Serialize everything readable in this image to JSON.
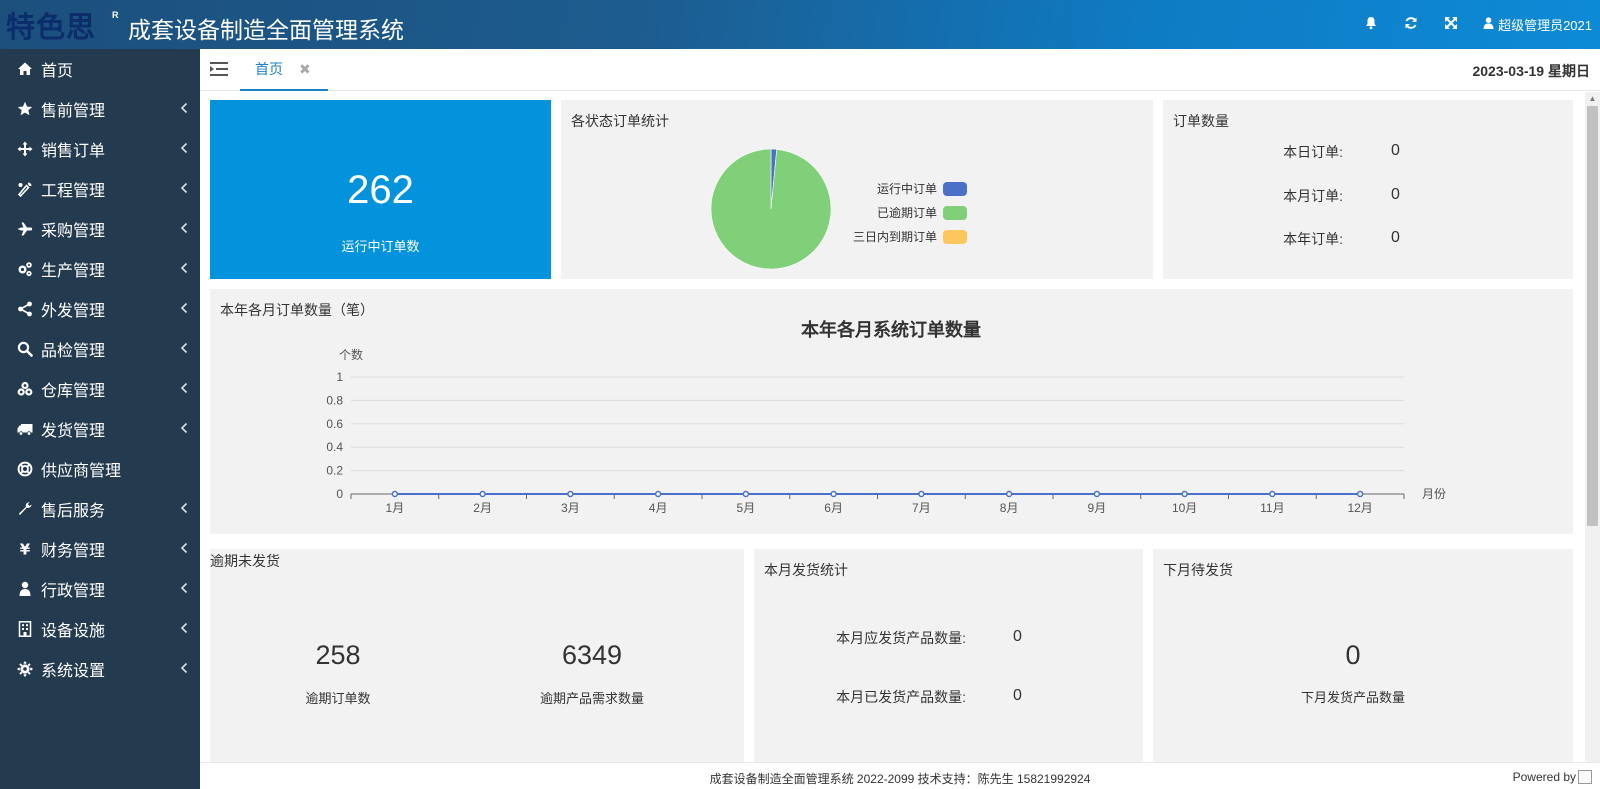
{
  "header": {
    "logo": "特色思",
    "logo_mark": "R",
    "title": "成套设备制造全面管理系统",
    "user": "超级管理员2021",
    "icons": [
      "bell-icon",
      "refresh-icon",
      "fullscreen-icon",
      "user-icon"
    ]
  },
  "sidebar": {
    "items": [
      {
        "label": "首页",
        "icon": "home-icon",
        "has_children": false
      },
      {
        "label": "售前管理",
        "icon": "star-icon",
        "has_children": true
      },
      {
        "label": "销售订单",
        "icon": "arrows-icon",
        "has_children": true
      },
      {
        "label": "工程管理",
        "icon": "wrench-tool-icon",
        "has_children": true
      },
      {
        "label": "采购管理",
        "icon": "plane-icon",
        "has_children": true
      },
      {
        "label": "生产管理",
        "icon": "gears-icon",
        "has_children": true
      },
      {
        "label": "外发管理",
        "icon": "share-icon",
        "has_children": true
      },
      {
        "label": "品检管理",
        "icon": "search-icon",
        "has_children": true
      },
      {
        "label": "仓库管理",
        "icon": "cubes-icon",
        "has_children": true
      },
      {
        "label": "发货管理",
        "icon": "truck-icon",
        "has_children": true
      },
      {
        "label": "供应商管理",
        "icon": "lifebuoy-icon",
        "has_children": false
      },
      {
        "label": "售后服务",
        "icon": "wrench-icon",
        "has_children": true
      },
      {
        "label": "财务管理",
        "icon": "yen-icon",
        "has_children": true
      },
      {
        "label": "行政管理",
        "icon": "person-icon",
        "has_children": true
      },
      {
        "label": "设备设施",
        "icon": "building-icon",
        "has_children": true
      },
      {
        "label": "系统设置",
        "icon": "gear-icon",
        "has_children": true
      }
    ]
  },
  "tabs": {
    "active": "首页",
    "close": "✖",
    "date": "2023-03-19 星期日"
  },
  "running_card": {
    "value": "262",
    "label": "运行中订单数"
  },
  "status_pie": {
    "title": "各状态订单统计",
    "legend": [
      {
        "label": "运行中订单",
        "color": "#4a70c8"
      },
      {
        "label": "已逾期订单",
        "color": "#80cf79"
      },
      {
        "label": "三日内到期订单",
        "color": "#fcc85e"
      }
    ]
  },
  "order_count": {
    "title": "订单数量",
    "rows": [
      {
        "label": "本日订单:",
        "value": "0"
      },
      {
        "label": "本月订单:",
        "value": "0"
      },
      {
        "label": "本年订单:",
        "value": "0"
      }
    ]
  },
  "monthly_panel": {
    "title": "本年各月订单数量（笔）"
  },
  "chart_data": [
    {
      "type": "pie",
      "labels": [
        "运行中订单",
        "已逾期订单",
        "三日内到期订单"
      ],
      "values": [
        4,
        258,
        0
      ],
      "colors": [
        "#4a70c8",
        "#80cf79",
        "#fcc85e"
      ]
    },
    {
      "type": "line",
      "title": "本年各月系统订单数量",
      "ylabel": "个数",
      "xlabel": "月份",
      "categories": [
        "1月",
        "2月",
        "3月",
        "4月",
        "5月",
        "6月",
        "7月",
        "8月",
        "9月",
        "10月",
        "11月",
        "12月"
      ],
      "values": [
        0,
        0,
        0,
        0,
        0,
        0,
        0,
        0,
        0,
        0,
        0,
        0
      ],
      "ylim": [
        0,
        1
      ],
      "yticks": [
        "1",
        "0.8",
        "0.6",
        "0.4",
        "0.2",
        "0"
      ],
      "color": "#4a70c8",
      "grid": true
    }
  ],
  "overdue": {
    "title": "逾期未发货",
    "orders_value": "258",
    "orders_label": "逾期订单数",
    "demand_value": "6349",
    "demand_label": "逾期产品需求数量"
  },
  "month_ship": {
    "title": "本月发货统计",
    "rows": [
      {
        "label": "本月应发货产品数量:",
        "value": "0"
      },
      {
        "label": "本月已发货产品数量:",
        "value": "0"
      }
    ]
  },
  "next_month": {
    "title": "下月待发货",
    "value": "0",
    "label": "下月发货产品数量"
  },
  "footer": {
    "text": "成套设备制造全面管理系统 2022-2099 技术支持：陈先生 15821992924",
    "powered": "Powered by"
  }
}
